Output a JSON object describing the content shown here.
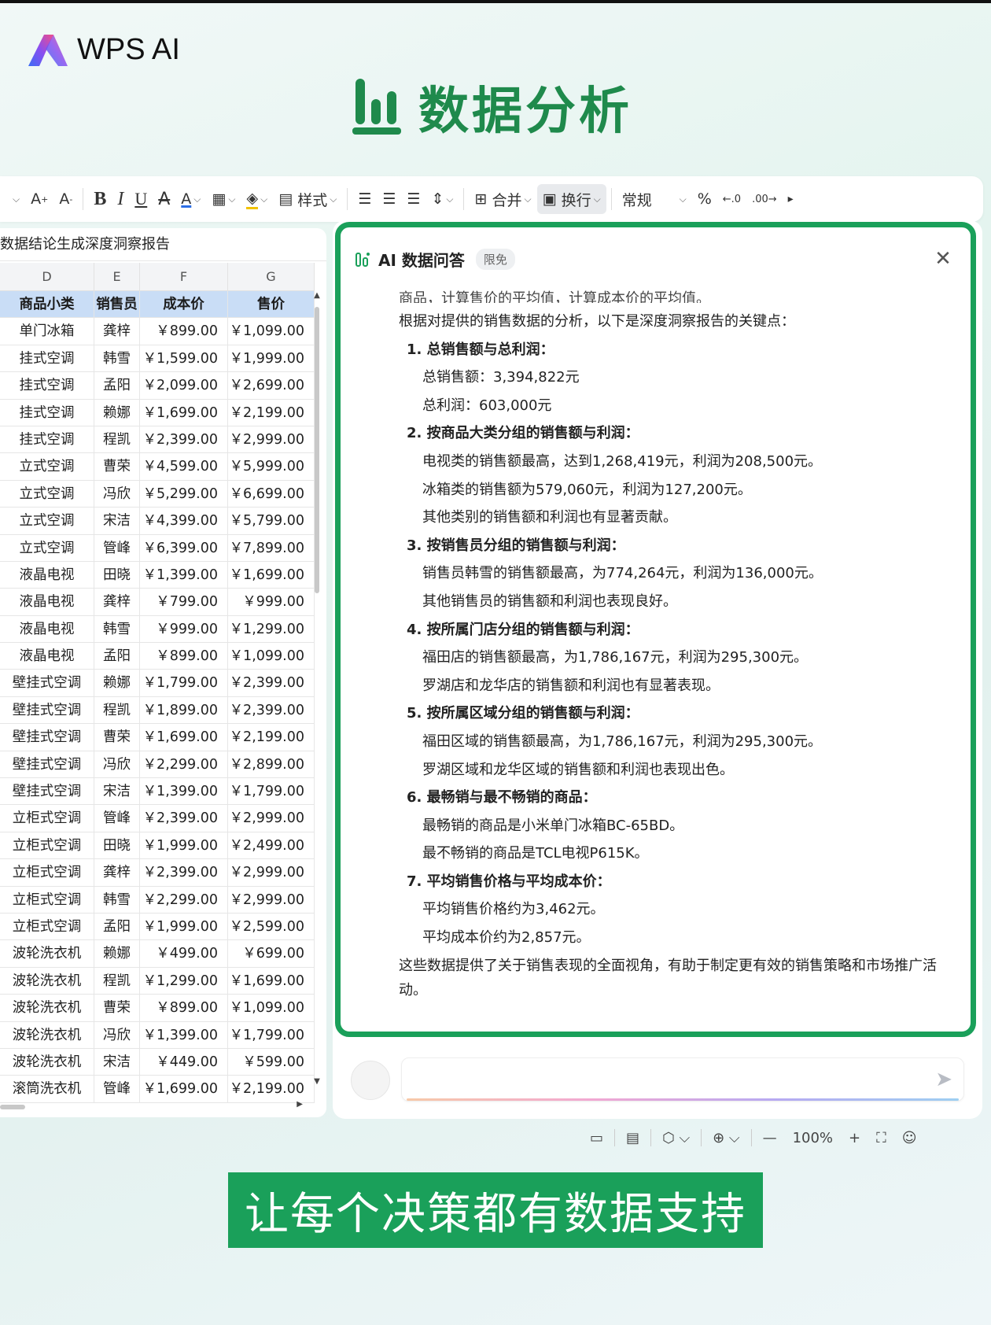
{
  "brand": {
    "logo_text": "WPS AI"
  },
  "hero": {
    "title": "数据分析"
  },
  "toolbar": {
    "style_label": "样式",
    "merge_label": "合并",
    "wrap_label": "换行",
    "format_value": "常规",
    "percent_label": "%"
  },
  "sheet": {
    "formula_text": "数据结论生成深度洞察报告",
    "columns": [
      "D",
      "E",
      "F",
      "G"
    ],
    "headers": [
      "商品小类",
      "销售员",
      "成本价",
      "售价"
    ],
    "rows": [
      [
        "单门冰箱",
        "龚梓",
        "￥899.00",
        "￥1,099.00"
      ],
      [
        "挂式空调",
        "韩雪",
        "￥1,599.00",
        "￥1,999.00"
      ],
      [
        "挂式空调",
        "孟阳",
        "￥2,099.00",
        "￥2,699.00"
      ],
      [
        "挂式空调",
        "赖娜",
        "￥1,699.00",
        "￥2,199.00"
      ],
      [
        "挂式空调",
        "程凯",
        "￥2,399.00",
        "￥2,999.00"
      ],
      [
        "立式空调",
        "曹荣",
        "￥4,599.00",
        "￥5,999.00"
      ],
      [
        "立式空调",
        "冯欣",
        "￥5,299.00",
        "￥6,699.00"
      ],
      [
        "立式空调",
        "宋洁",
        "￥4,399.00",
        "￥5,799.00"
      ],
      [
        "立式空调",
        "管峰",
        "￥6,399.00",
        "￥7,899.00"
      ],
      [
        "液晶电视",
        "田晓",
        "￥1,399.00",
        "￥1,699.00"
      ],
      [
        "液晶电视",
        "龚梓",
        "￥799.00",
        "￥999.00"
      ],
      [
        "液晶电视",
        "韩雪",
        "￥999.00",
        "￥1,299.00"
      ],
      [
        "液晶电视",
        "孟阳",
        "￥899.00",
        "￥1,099.00"
      ],
      [
        "壁挂式空调",
        "赖娜",
        "￥1,799.00",
        "￥2,399.00"
      ],
      [
        "壁挂式空调",
        "程凯",
        "￥1,899.00",
        "￥2,399.00"
      ],
      [
        "壁挂式空调",
        "曹荣",
        "￥1,699.00",
        "￥2,199.00"
      ],
      [
        "壁挂式空调",
        "冯欣",
        "￥2,299.00",
        "￥2,899.00"
      ],
      [
        "壁挂式空调",
        "宋洁",
        "￥1,399.00",
        "￥1,799.00"
      ],
      [
        "立柜式空调",
        "管峰",
        "￥2,399.00",
        "￥2,999.00"
      ],
      [
        "立柜式空调",
        "田晓",
        "￥1,999.00",
        "￥2,499.00"
      ],
      [
        "立柜式空调",
        "龚梓",
        "￥2,399.00",
        "￥2,999.00"
      ],
      [
        "立柜式空调",
        "韩雪",
        "￥2,299.00",
        "￥2,999.00"
      ],
      [
        "立柜式空调",
        "孟阳",
        "￥1,999.00",
        "￥2,599.00"
      ],
      [
        "波轮洗衣机",
        "赖娜",
        "￥499.00",
        "￥699.00"
      ],
      [
        "波轮洗衣机",
        "程凯",
        "￥1,299.00",
        "￥1,699.00"
      ],
      [
        "波轮洗衣机",
        "曹荣",
        "￥899.00",
        "￥1,099.00"
      ],
      [
        "波轮洗衣机",
        "冯欣",
        "￥1,399.00",
        "￥1,799.00"
      ],
      [
        "波轮洗衣机",
        "宋洁",
        "￥449.00",
        "￥599.00"
      ],
      [
        "滚筒洗衣机",
        "管峰",
        "￥1,699.00",
        "￥2,199.00"
      ]
    ]
  },
  "ai_panel": {
    "title": "AI 数据问答",
    "badge": "限免",
    "cut_line": "商品，计算售价的平均值，计算成本价的平均值。",
    "intro": "根据对提供的销售数据的分析，以下是深度洞察报告的关键点：",
    "sections": [
      {
        "heading": "1. 总销售额与总利润：",
        "items": [
          "总销售额：3,394,822元",
          "总利润：603,000元"
        ]
      },
      {
        "heading": "2. 按商品大类分组的销售额与利润：",
        "items": [
          "电视类的销售额最高，达到1,268,419元，利润为208,500元。",
          "冰箱类的销售额为579,060元，利润为127,200元。",
          "其他类别的销售额和利润也有显著贡献。"
        ]
      },
      {
        "heading": "3. 按销售员分组的销售额与利润：",
        "items": [
          "销售员韩雪的销售额最高，为774,264元，利润为136,000元。",
          "其他销售员的销售额和利润也表现良好。"
        ]
      },
      {
        "heading": "4. 按所属门店分组的销售额与利润：",
        "items": [
          "福田店的销售额最高，为1,786,167元，利润为295,300元。",
          "罗湖店和龙华店的销售额和利润也有显著表现。"
        ]
      },
      {
        "heading": "5. 按所属区域分组的销售额与利润：",
        "items": [
          "福田区域的销售额最高，为1,786,167元，利润为295,300元。",
          "罗湖区域和龙华区域的销售额和利润也表现出色。"
        ]
      },
      {
        "heading": "6. 最畅销与最不畅销的商品：",
        "items": [
          "最畅销的商品是小米单门冰箱BC-65BD。",
          "最不畅销的商品是TCL电视P615K。"
        ]
      },
      {
        "heading": "7. 平均销售价格与平均成本价：",
        "items": [
          "平均销售价格约为3,462元。",
          "平均成本价约为2,857元。"
        ]
      }
    ],
    "conclusion": "这些数据提供了关于销售表现的全面视角，有助于制定更有效的销售策略和市场推广活动。"
  },
  "statusbar": {
    "zoom": "100%"
  },
  "caption": {
    "text": "让每个决策都有数据支持"
  },
  "colors": {
    "brand_green": "#1aa05a",
    "header_blue": "#c9ddf6"
  }
}
